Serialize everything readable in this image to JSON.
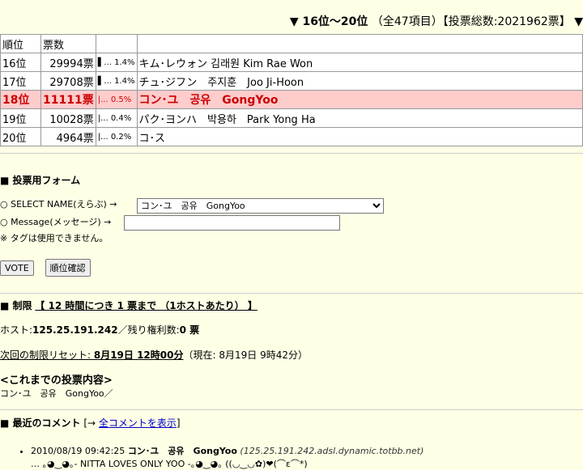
{
  "header": {
    "range": "▼ 16位～20位",
    "info": "（全47項目）【投票総数:2021962票】",
    "nav_next": "▼"
  },
  "table": {
    "headers": [
      "順位",
      "票数",
      "",
      ""
    ],
    "rows": [
      {
        "rank": "16位",
        "votes": "29994票",
        "pct": "1.4%",
        "name": "キム･レウォン 김래원 Kim Rae Won",
        "bar": "▌..."
      },
      {
        "rank": "17位",
        "votes": "29708票",
        "pct": "1.4%",
        "name": "チュ･ジフン　주지훈　Joo Ji-Hoon",
        "bar": "▌..."
      },
      {
        "rank": "18位",
        "votes": "11111票",
        "pct": "0.5%",
        "name": "コン･ユ　공유　GongYoo",
        "bar": "|..."
      },
      {
        "rank": "19位",
        "votes": "10028票",
        "pct": "0.4%",
        "name": "パク･ヨンハ　박용하　Park Yong Ha",
        "bar": "|..."
      },
      {
        "rank": "20位",
        "votes": "4964票",
        "pct": "0.2%",
        "name": "コ･ス",
        "bar": "|..."
      }
    ]
  },
  "form": {
    "title": "■ 投票用フォーム",
    "select_label": "SELECT NAME(えらぶ) →",
    "select_value": "コン･ユ　공유　GongYoo",
    "message_label": "Message(メッセージ) →",
    "message_value": "",
    "tag_note": "※ タグは使用できません。",
    "vote_button": "VOTE",
    "rank_button": "順位確認"
  },
  "limit": {
    "title_prefix": "■ 制限",
    "title_rule": "【 12 時間につき 1 票まで （1ホストあたり） 】",
    "host_label": "ホスト:",
    "host_value": "125.25.191.242",
    "remaining_label": "／残り権利数:",
    "remaining_value": "0 票",
    "reset_label": "次回の制限リセット: ",
    "reset_value": "8月19日 12時00分",
    "now_text": "（現在: 8月19日 9時42分）",
    "history_title": "<これまでの投票内容>",
    "history_value": "コン･ユ　공유　GongYoo／"
  },
  "comments": {
    "title": "■ 最近のコメント",
    "bracket_open": " [→ ",
    "link": "全コメントを表示",
    "bracket_close": "]",
    "items": [
      {
        "time": "2010/08/19 09:42:25",
        "name": "コン･ユ　공유　GongYoo",
        "ip": "(125.25.191.242.adsl.dynamic.totbb.net)",
        "text": "… ｡◕‿◕｡- NITTA LOVES ONLY YOO -｡◕‿◕｡ ((◡‿◡✿)❤(⌒ε⌒*)"
      }
    ]
  },
  "colors": {
    "background": "#ffffe6",
    "highlight_row": "#ffcccc",
    "highlight_text": "#cc0000",
    "link": "#0000cc"
  }
}
